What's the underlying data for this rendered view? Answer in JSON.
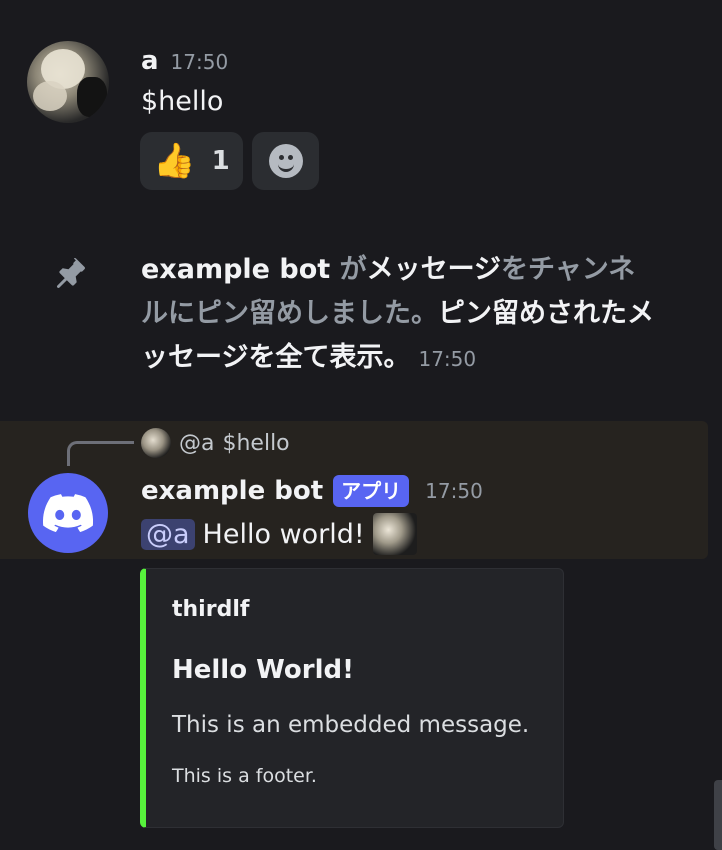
{
  "message1": {
    "author": "a",
    "timestamp": "17:50",
    "content": "$hello",
    "reactions": [
      {
        "emoji": "👍",
        "count": "1"
      }
    ],
    "add_reaction_icon": "smiley-face-icon"
  },
  "system_message": {
    "icon": "pin-icon",
    "actor": "example bot",
    "part1": "が",
    "part2": "メッセージ",
    "part3": "をチャンネルにピン留めしました。",
    "link": "ピン留めされたメッセージを全て表示。",
    "timestamp": "17:50"
  },
  "bot_message": {
    "reply": {
      "mention": "@a",
      "content": "$hello"
    },
    "author": "example bot",
    "badge": "アプリ",
    "timestamp": "17:50",
    "mention": "@a",
    "content": "Hello world!",
    "embed": {
      "color": "#57f23c",
      "author": "thirdlf",
      "title": "Hello World!",
      "description": "This is an embedded message.",
      "footer": "This is a footer."
    }
  },
  "colors": {
    "background": "#1a1a1e",
    "blurple": "#5865f2",
    "embed_accent": "#57f23c"
  }
}
